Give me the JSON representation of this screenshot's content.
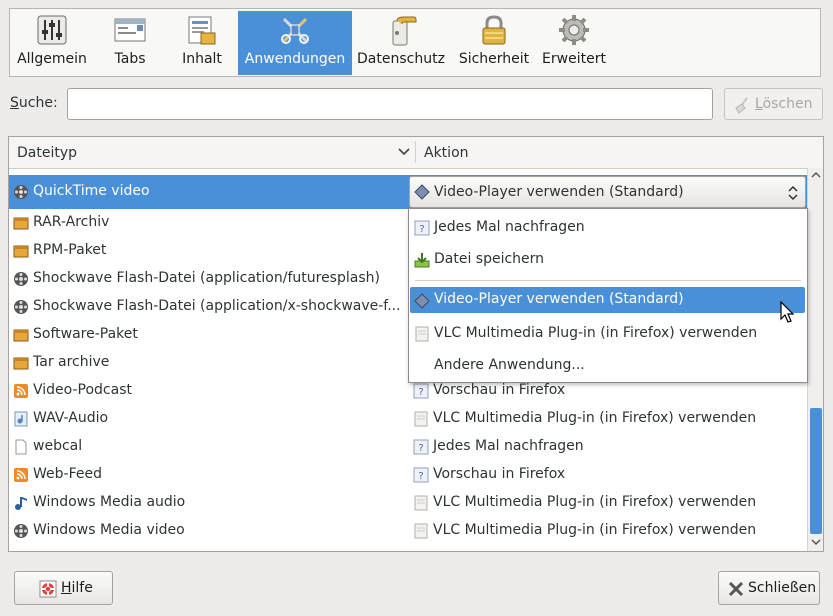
{
  "toolbar": {
    "items": [
      {
        "label": "Allgemein",
        "icon": "sliders-icon"
      },
      {
        "label": "Tabs",
        "icon": "tabs-icon"
      },
      {
        "label": "Inhalt",
        "icon": "content-icon"
      },
      {
        "label": "Anwendungen",
        "icon": "applications-icon",
        "active": true
      },
      {
        "label": "Datenschutz",
        "icon": "privacy-icon"
      },
      {
        "label": "Sicherheit",
        "icon": "lock-icon"
      },
      {
        "label": "Erweitert",
        "icon": "gear-icon"
      }
    ]
  },
  "search": {
    "label": "Suche:",
    "value": "",
    "clear_label": "Löschen"
  },
  "table": {
    "col_type": "Dateityp",
    "col_action": "Aktion",
    "selected": {
      "type": "QuickTime video",
      "action": "Video-Player verwenden (Standard)"
    },
    "rows": [
      {
        "type": "RAR-Archiv",
        "action": ""
      },
      {
        "type": "RPM-Paket",
        "action": ""
      },
      {
        "type": "Shockwave Flash-Datei (application/futuresplash)",
        "action": ""
      },
      {
        "type": "Shockwave Flash-Datei (application/x-shockwave-f...",
        "action": ""
      },
      {
        "type": "Software-Paket",
        "action": ""
      },
      {
        "type": "Tar archive",
        "action": ""
      },
      {
        "type": "Video-Podcast",
        "action": "Vorschau in Firefox"
      },
      {
        "type": "WAV-Audio",
        "action": "VLC Multimedia Plug-in (in Firefox) verwenden"
      },
      {
        "type": "webcal",
        "action": "Jedes Mal nachfragen"
      },
      {
        "type": "Web-Feed",
        "action": "Vorschau in Firefox"
      },
      {
        "type": "Windows Media audio",
        "action": "VLC Multimedia Plug-in (in Firefox) verwenden"
      },
      {
        "type": "Windows Media video",
        "action": "VLC Multimedia Plug-in (in Firefox) verwenden"
      }
    ]
  },
  "menu": {
    "items": [
      {
        "label": "Jedes Mal nachfragen"
      },
      {
        "label": "Datei speichern"
      },
      {
        "label": "Video-Player verwenden (Standard)"
      },
      {
        "label": "VLC Multimedia Plug-in (in Firefox) verwenden"
      },
      {
        "label": "Andere Anwendung..."
      }
    ]
  },
  "buttons": {
    "help_label": "Hilfe",
    "close_label": "Schließen"
  },
  "colors": {
    "accent": "#4a90d9"
  }
}
